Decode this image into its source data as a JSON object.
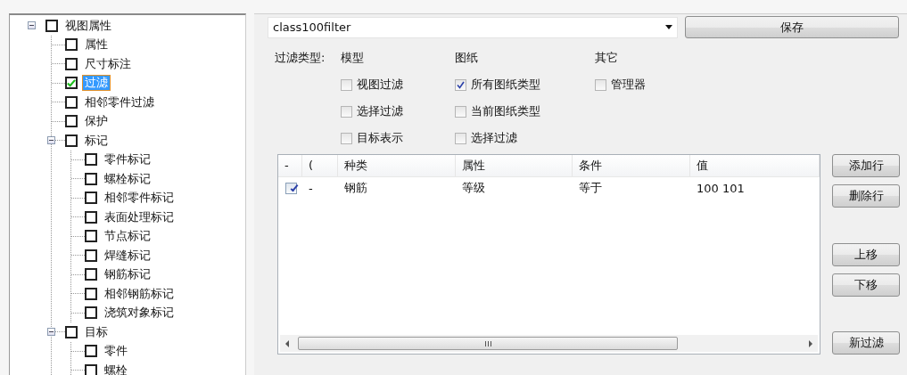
{
  "tree": {
    "items": [
      {
        "label": "视图属性",
        "checked": false,
        "selected": false,
        "expanded": true,
        "children": [
          {
            "label": "属性",
            "checked": false,
            "selected": false
          },
          {
            "label": "尺寸标注",
            "checked": false,
            "selected": false
          },
          {
            "label": "过滤",
            "checked": true,
            "selected": true
          },
          {
            "label": "相邻零件过滤",
            "checked": false,
            "selected": false
          },
          {
            "label": "保护",
            "checked": false,
            "selected": false
          },
          {
            "label": "标记",
            "checked": false,
            "selected": false,
            "expanded": true,
            "children": [
              {
                "label": "零件标记",
                "checked": false,
                "selected": false
              },
              {
                "label": "螺栓标记",
                "checked": false,
                "selected": false
              },
              {
                "label": "相邻零件标记",
                "checked": false,
                "selected": false
              },
              {
                "label": "表面处理标记",
                "checked": false,
                "selected": false
              },
              {
                "label": "节点标记",
                "checked": false,
                "selected": false
              },
              {
                "label": "焊缝标记",
                "checked": false,
                "selected": false
              },
              {
                "label": "钢筋标记",
                "checked": false,
                "selected": false
              },
              {
                "label": "相邻钢筋标记",
                "checked": false,
                "selected": false
              },
              {
                "label": "浇筑对象标记",
                "checked": false,
                "selected": false
              }
            ]
          },
          {
            "label": "目标",
            "checked": false,
            "selected": false,
            "expanded": true,
            "children": [
              {
                "label": "零件",
                "checked": false,
                "selected": false
              },
              {
                "label": "螺栓",
                "checked": false,
                "selected": false
              }
            ]
          }
        ]
      }
    ]
  },
  "filter": {
    "name": "class100filter",
    "save_button": "保存",
    "type_label": "过滤类型:",
    "groups": [
      {
        "title": "模型",
        "options": [
          {
            "label": "视图过滤",
            "checked": false
          },
          {
            "label": "选择过滤",
            "checked": false
          },
          {
            "label": "目标表示",
            "checked": false
          }
        ]
      },
      {
        "title": "图纸",
        "options": [
          {
            "label": "所有图纸类型",
            "checked": true
          },
          {
            "label": "当前图纸类型",
            "checked": false
          },
          {
            "label": "选择过滤",
            "checked": false
          }
        ]
      },
      {
        "title": "其它",
        "options": [
          {
            "label": "管理器",
            "checked": false
          }
        ]
      }
    ]
  },
  "table": {
    "columns": [
      "-",
      "(",
      "种类",
      "属性",
      "条件",
      "值"
    ],
    "rows": [
      {
        "checked": true,
        "cells": [
          "",
          "-",
          "钢筋",
          "等级",
          "等于",
          "100 101"
        ]
      }
    ]
  },
  "button_groups": [
    [
      "添加行",
      "删除行"
    ],
    [
      "上移",
      "下移"
    ],
    [
      "新过滤"
    ]
  ]
}
